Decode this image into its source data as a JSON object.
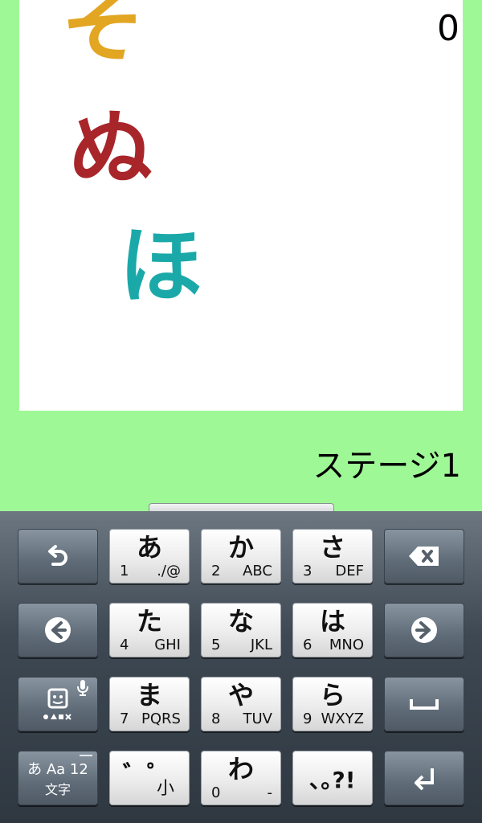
{
  "game": {
    "score": "0",
    "stage": "ステージ1",
    "characters": [
      {
        "char": "そ",
        "color": "#e2a623"
      },
      {
        "char": "ぬ",
        "color": "#a8252a"
      },
      {
        "char": "ほ",
        "color": "#1aa9a8"
      }
    ]
  },
  "keyboard": {
    "keys": {
      "a": {
        "kana": "あ",
        "num": "1",
        "latin": "./@"
      },
      "ka": {
        "kana": "か",
        "num": "2",
        "latin": "ABC"
      },
      "sa": {
        "kana": "さ",
        "num": "3",
        "latin": "DEF"
      },
      "ta": {
        "kana": "た",
        "num": "4",
        "latin": "GHI"
      },
      "na": {
        "kana": "な",
        "num": "5",
        "latin": "JKL"
      },
      "ha": {
        "kana": "は",
        "num": "6",
        "latin": "MNO"
      },
      "ma": {
        "kana": "ま",
        "num": "7",
        "latin": "PQRS"
      },
      "ya": {
        "kana": "や",
        "num": "8",
        "latin": "TUV"
      },
      "ra": {
        "kana": "ら",
        "num": "9",
        "latin": "WXYZ"
      },
      "dakuten": {
        "marks": "゛゜",
        "small": "小"
      },
      "wa": {
        "kana": "わ",
        "num": "0",
        "latin": "-"
      },
      "punct": {
        "label": "､｡?!"
      },
      "mode": {
        "top": "あ Aa 12",
        "bottom": "文字"
      }
    },
    "icons": {
      "undo": "undo-arrow-icon",
      "backspace": "backspace-icon",
      "left": "arrow-left-icon",
      "right": "arrow-right-icon",
      "emoji": "emoji-face-icon",
      "mic": "mic-icon",
      "space": "space-icon",
      "enter": "enter-icon"
    }
  }
}
